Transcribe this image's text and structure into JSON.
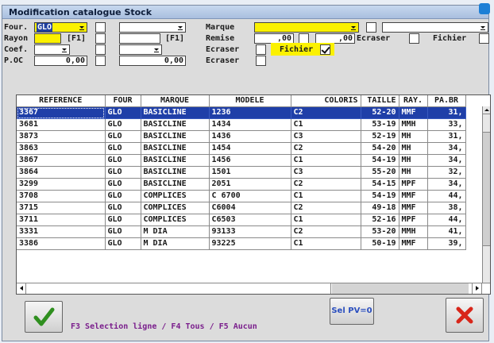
{
  "window": {
    "title": "Modification catalogue Stock"
  },
  "form": {
    "four_label": "Four.",
    "four_value": "GLO",
    "rayon_label": "Rayon",
    "f1_left": "[F1]",
    "f1_right": "[F1]",
    "coef_label": "Coef.",
    "poc_label": "P.OC",
    "poc_value1": "0,00",
    "poc_value2": "0,00",
    "marque_label": "Marque",
    "remise_label": "Remise",
    "remise_value1": ",00",
    "remise_value2": ",00",
    "ecraser1": "Ecraser",
    "ecraser2": "Ecraser",
    "ecraser3": "Ecraser",
    "fichier_top": "Fichier",
    "fichier_hl": "Fichier",
    "fichier_checked": true,
    "highlight_color": "#fbf100"
  },
  "table": {
    "columns": [
      "REFERENCE",
      "FOUR",
      "MARQUE",
      "MODELE",
      "COLORIS",
      "TAILLE",
      "RAY.",
      "PA.BR"
    ],
    "rows": [
      [
        "3367",
        "GLO",
        "BASICLINE",
        "1236",
        "C2",
        "52-20",
        "MMF",
        "31,"
      ],
      [
        "3681",
        "GLO",
        "BASICLINE",
        "1434",
        "C1",
        "53-19",
        "MMH",
        "33,"
      ],
      [
        "3873",
        "GLO",
        "BASICLINE",
        "1436",
        "C3",
        "52-19",
        "MH",
        "31,"
      ],
      [
        "3863",
        "GLO",
        "BASICLINE",
        "1454",
        "C2",
        "54-20",
        "MH",
        "34,"
      ],
      [
        "3867",
        "GLO",
        "BASICLINE",
        "1456",
        "C1",
        "54-19",
        "MH",
        "34,"
      ],
      [
        "3864",
        "GLO",
        "BASICLINE",
        "1501",
        "C3",
        "55-20",
        "MH",
        "32,"
      ],
      [
        "3299",
        "GLO",
        "BASICLINE",
        "2051",
        "C2",
        "54-15",
        "MPF",
        "34,"
      ],
      [
        "3708",
        "GLO",
        "COMPLICES",
        "C 6700",
        "C1",
        "54-19",
        "MMF",
        "44,"
      ],
      [
        "3715",
        "GLO",
        "COMPLICES",
        "C6004",
        "C2",
        "49-18",
        "MMF",
        "38,"
      ],
      [
        "3711",
        "GLO",
        "COMPLICES",
        "C6503",
        "C1",
        "52-16",
        "MPF",
        "44,"
      ],
      [
        "3331",
        "GLO",
        "M DIA",
        "93133",
        "C2",
        "53-20",
        "MMH",
        "41,"
      ],
      [
        "3386",
        "GLO",
        "M DIA",
        "93225",
        "C1",
        "50-19",
        "MMF",
        "39,"
      ]
    ],
    "selected_row": 0,
    "selection_color": "#1f3fa8"
  },
  "footer": {
    "hint": "F3 Selection ligne / F4 Tous / F5 Aucun",
    "selpv_label": "Sel PV=0",
    "ok_icon": "check-icon",
    "cancel_icon": "cross-icon"
  }
}
